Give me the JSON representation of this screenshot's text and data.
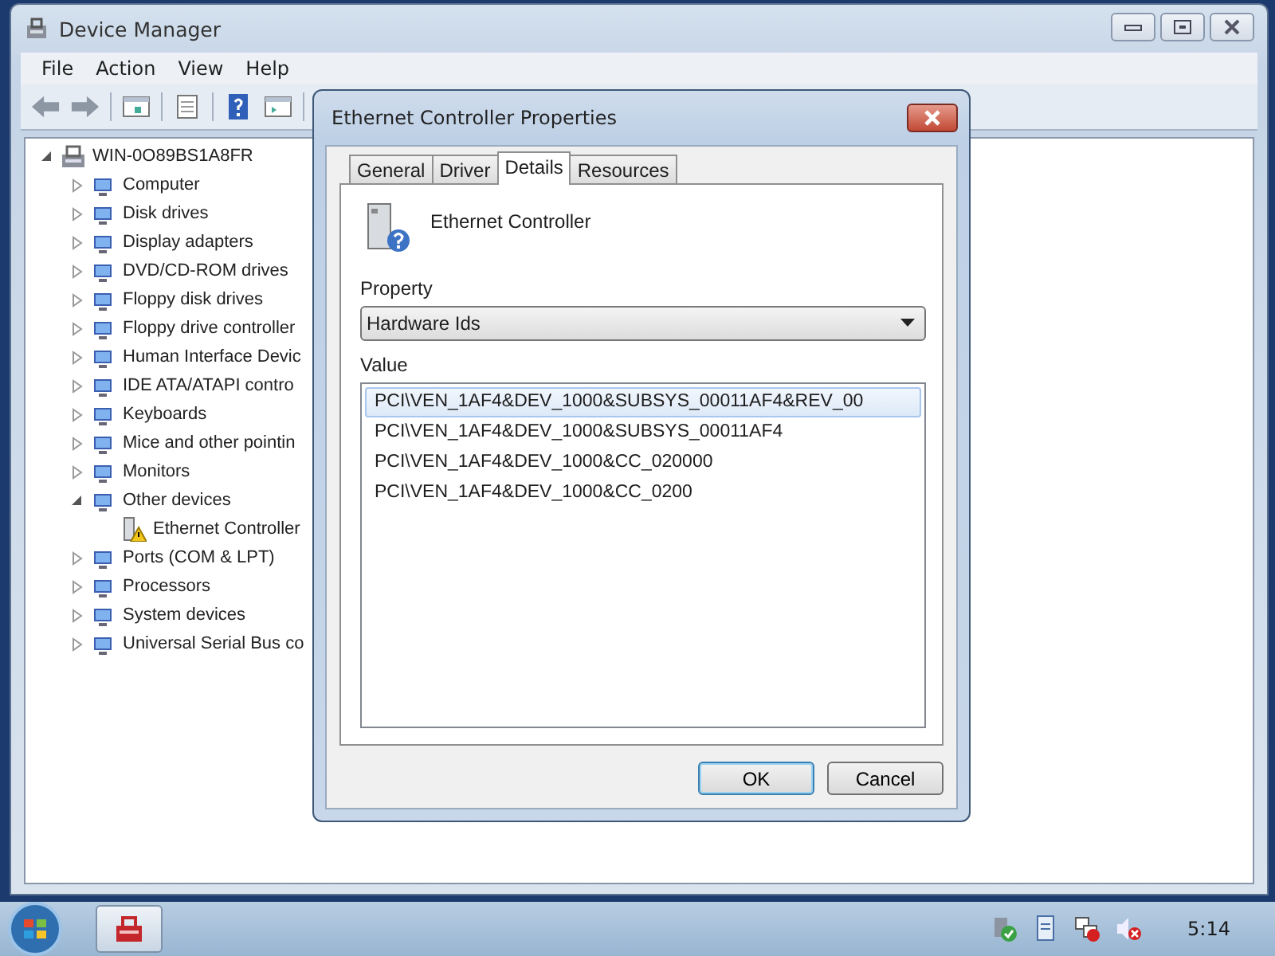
{
  "window": {
    "title": "Device Manager"
  },
  "menu": [
    "File",
    "Action",
    "View",
    "Help"
  ],
  "tree": {
    "label": "WIN-0O89BS1A8FR",
    "expanded": true,
    "children": [
      {
        "label": "Computer",
        "expanded": false
      },
      {
        "label": "Disk drives",
        "expanded": false
      },
      {
        "label": "Display adapters",
        "expanded": false
      },
      {
        "label": "DVD/CD-ROM drives",
        "expanded": false
      },
      {
        "label": "Floppy disk drives",
        "expanded": false
      },
      {
        "label": "Floppy drive controller",
        "expanded": false
      },
      {
        "label": "Human Interface Devic",
        "expanded": false
      },
      {
        "label": "IDE ATA/ATAPI contro",
        "expanded": false
      },
      {
        "label": "Keyboards",
        "expanded": false
      },
      {
        "label": "Mice and other pointin",
        "expanded": false
      },
      {
        "label": "Monitors",
        "expanded": false
      },
      {
        "label": "Other devices",
        "expanded": true,
        "children": [
          {
            "label": "Ethernet Controller",
            "warning": true
          }
        ]
      },
      {
        "label": "Ports (COM & LPT)",
        "expanded": false
      },
      {
        "label": "Processors",
        "expanded": false
      },
      {
        "label": "System devices",
        "expanded": false
      },
      {
        "label": "Universal Serial Bus co",
        "expanded": false
      }
    ]
  },
  "dialog": {
    "title": "Ethernet Controller Properties",
    "tabs": [
      {
        "label": "General",
        "selected": false
      },
      {
        "label": "Driver",
        "selected": false
      },
      {
        "label": "Details",
        "selected": true
      },
      {
        "label": "Resources",
        "selected": false
      }
    ],
    "device_name": "Ethernet Controller",
    "property_label": "Property",
    "property_value": "Hardware Ids",
    "value_label": "Value",
    "values": [
      {
        "text": "PCI\\VEN_1AF4&DEV_1000&SUBSYS_00011AF4&REV_00",
        "selected": true
      },
      {
        "text": "PCI\\VEN_1AF4&DEV_1000&SUBSYS_00011AF4",
        "selected": false
      },
      {
        "text": "PCI\\VEN_1AF4&DEV_1000&CC_020000",
        "selected": false
      },
      {
        "text": "PCI\\VEN_1AF4&DEV_1000&CC_0200",
        "selected": false
      }
    ],
    "buttons": [
      {
        "label": "OK",
        "default": true
      },
      {
        "label": "Cancel",
        "default": false
      }
    ]
  },
  "taskbar": {
    "clock": "5:14"
  }
}
